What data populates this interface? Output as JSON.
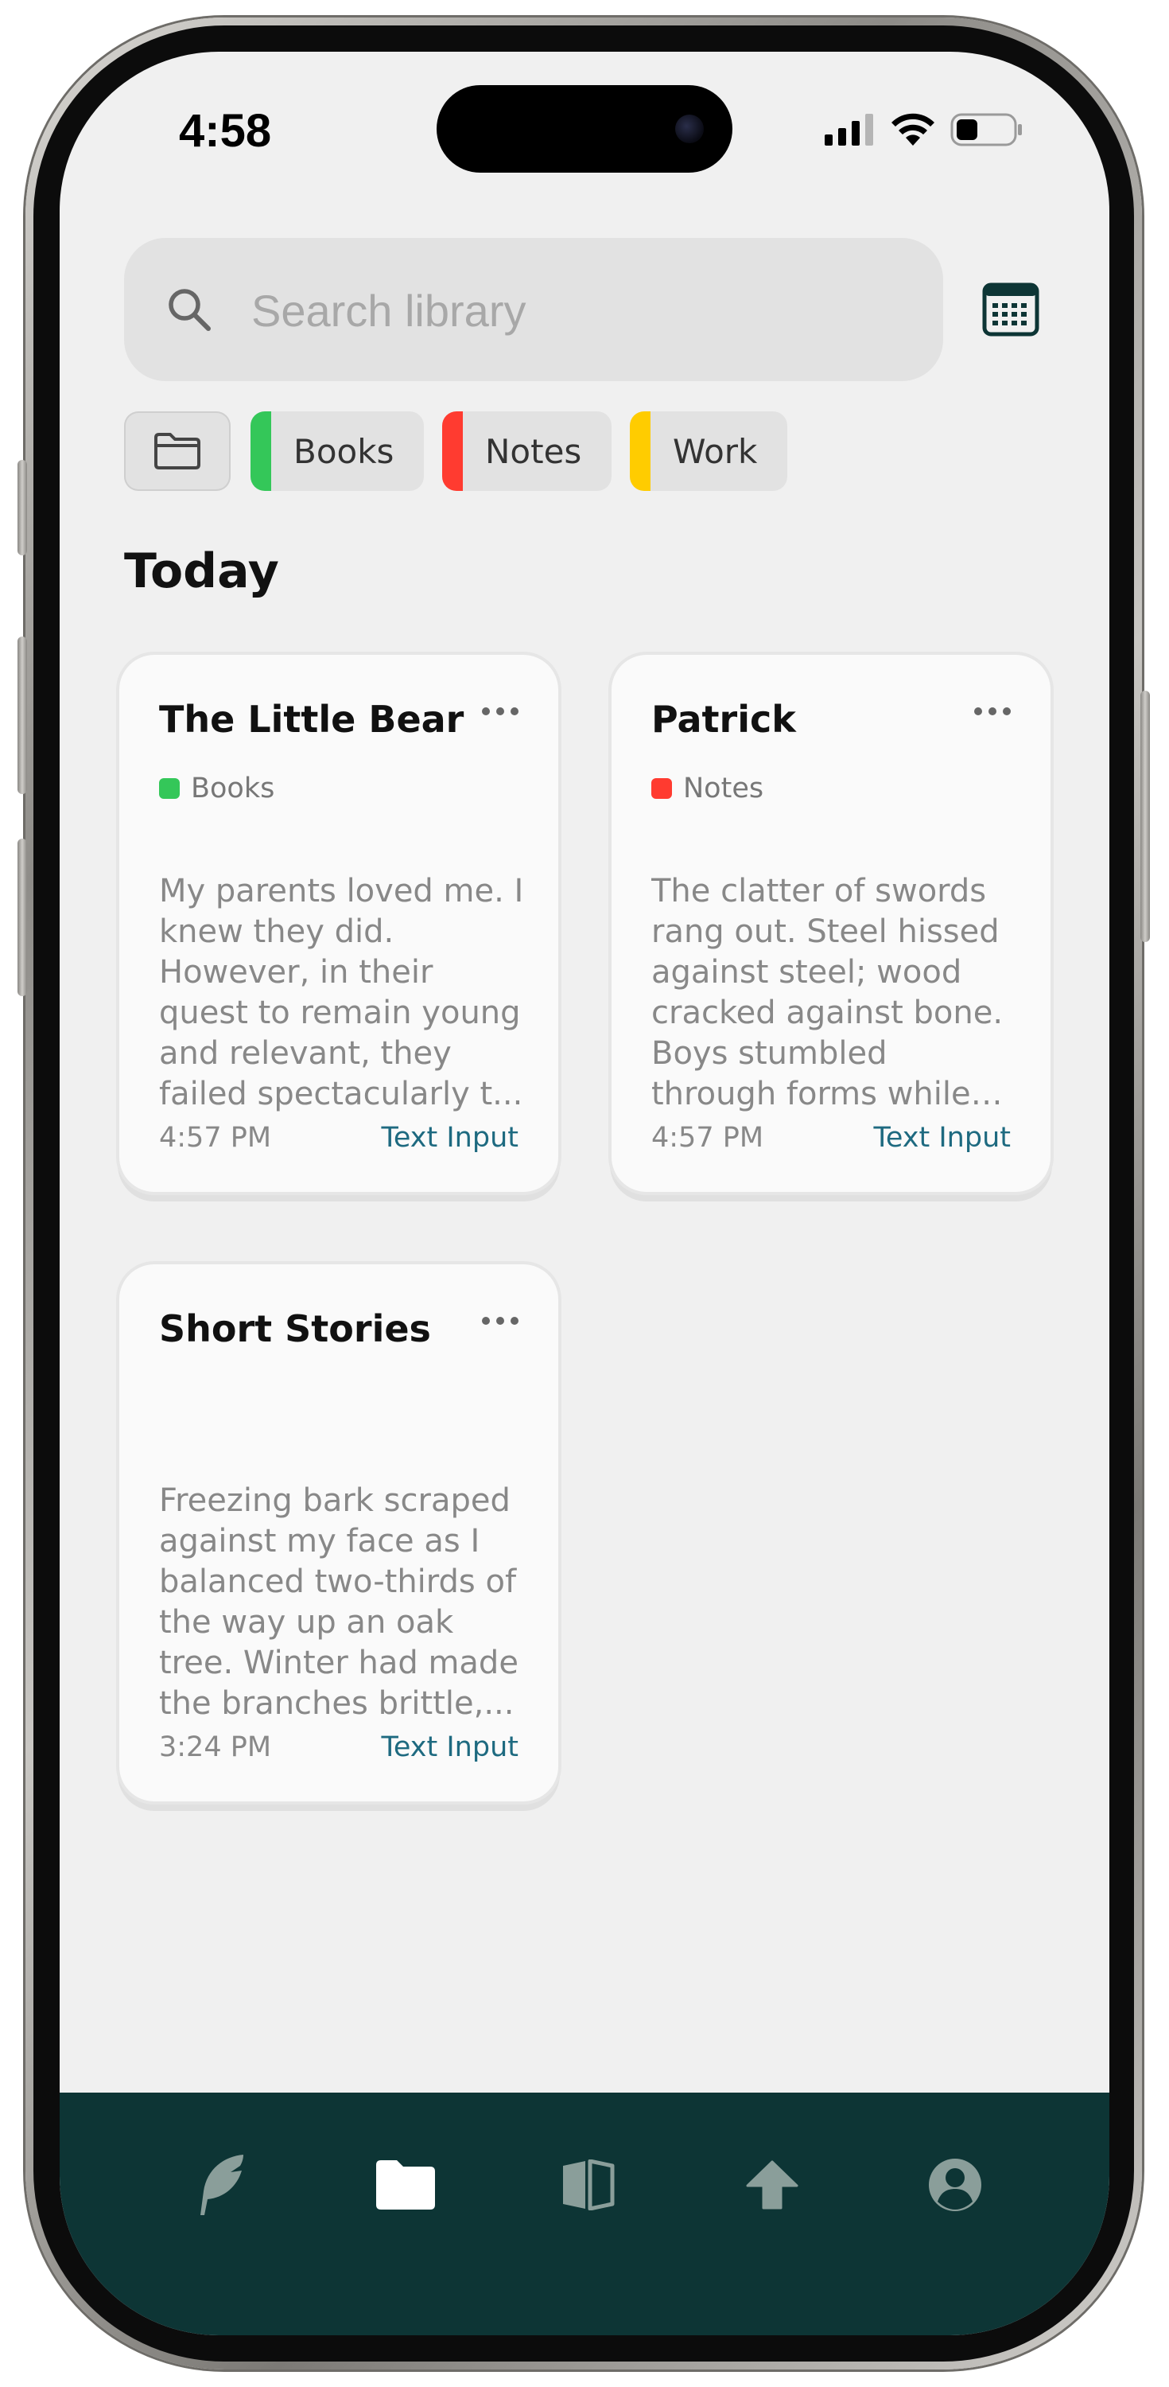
{
  "status_bar": {
    "time": "4:58"
  },
  "search": {
    "placeholder": "Search library"
  },
  "filters": [
    {
      "label": "Books",
      "color": "#34c759"
    },
    {
      "label": "Notes",
      "color": "#ff3b30"
    },
    {
      "label": "Work",
      "color": "#ffcc00"
    }
  ],
  "section": {
    "title": "Today"
  },
  "cards": [
    {
      "title": "The Little Bear",
      "tag": "Books",
      "tag_color": "#34c759",
      "body": "My parents loved me. I knew they did. However, in their quest to remain young and relevant, they failed spectacularly t...",
      "time": "4:57 PM",
      "source": "Text Input"
    },
    {
      "title": "Patrick",
      "tag": "Notes",
      "tag_color": "#ff3b30",
      "body": "The clatter of swords rang out. Steel hissed against steel; wood cracked against bone. Boys stumbled through forms while their par...",
      "time": "4:57 PM",
      "source": "Text Input"
    },
    {
      "title": "Short Stories",
      "tag": "",
      "body": "Freezing bark scraped against my face as I balanced two-thirds of the way up an oak tree. Winter had made the branches brittle,...",
      "time": "3:24 PM",
      "source": "Text Input"
    }
  ],
  "bottom_nav": [
    {
      "icon": "feather-icon",
      "active": false
    },
    {
      "icon": "folder-icon",
      "active": true
    },
    {
      "icon": "book-icon",
      "active": false
    },
    {
      "icon": "upload-arrow-icon",
      "active": false
    },
    {
      "icon": "profile-icon",
      "active": false
    }
  ],
  "colors": {
    "background": "#f0f0f0",
    "nav_background": "#0d3535",
    "accent": "#1e6a80",
    "nav_icon_inactive": "#8a9e9a",
    "nav_icon_active": "#ffffff"
  }
}
